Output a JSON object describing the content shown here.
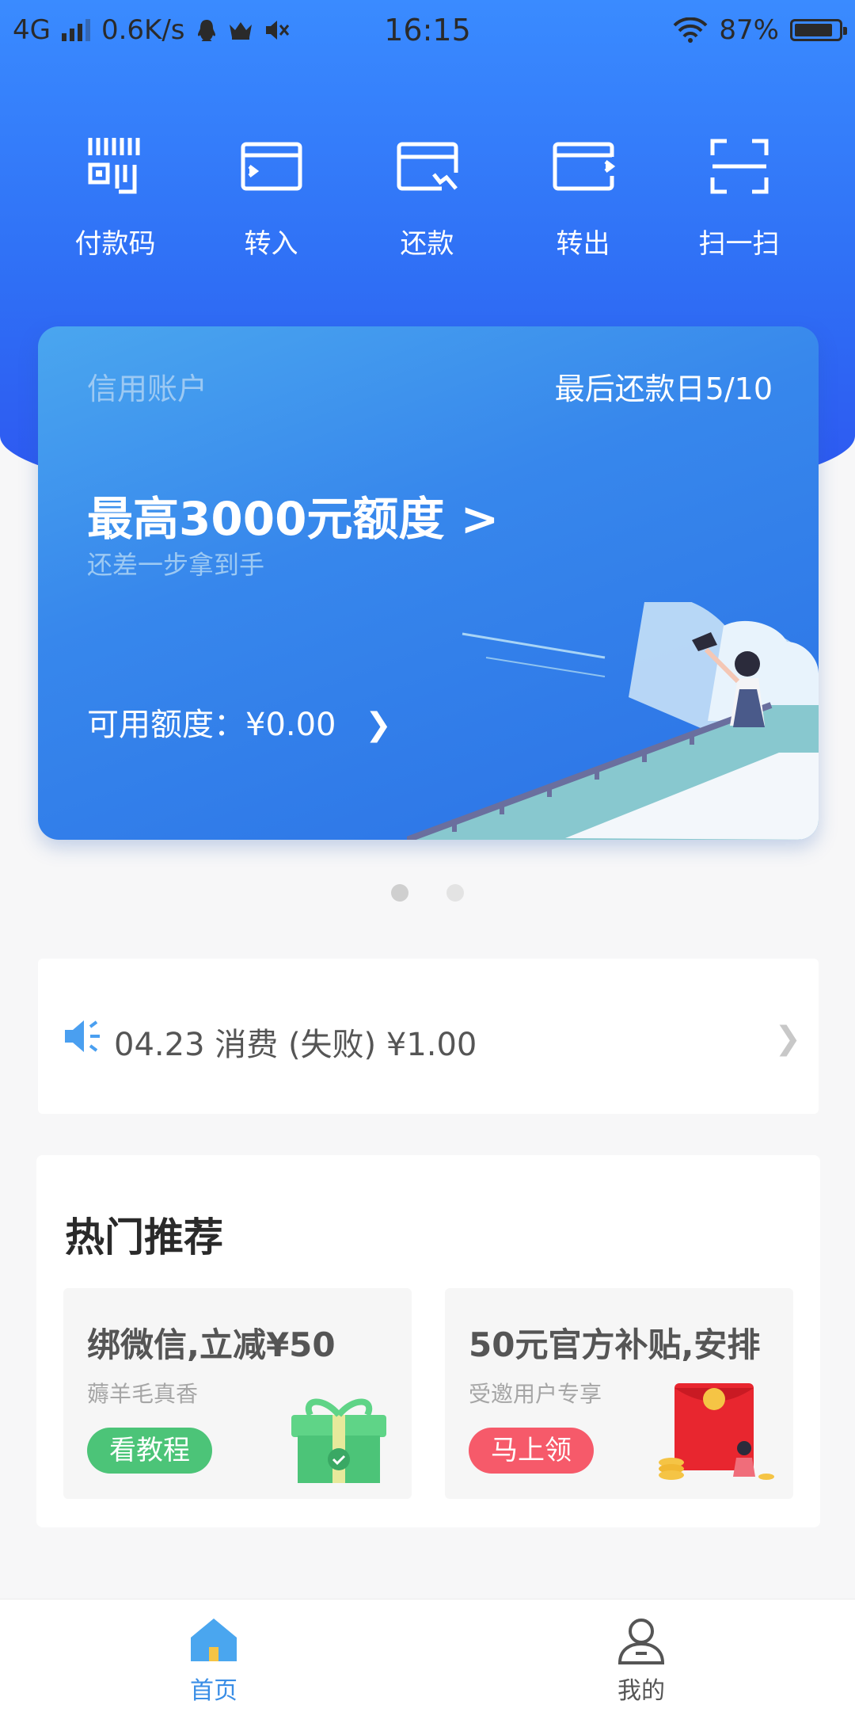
{
  "status_bar": {
    "network": "4G",
    "speed": "0.6K/s",
    "time": "16:15",
    "battery": "87%",
    "battery_level": 0.87
  },
  "quick_actions": [
    {
      "label": "付款码",
      "icon": "barcode-icon"
    },
    {
      "label": "转入",
      "icon": "transfer-in-icon"
    },
    {
      "label": "还款",
      "icon": "repay-icon"
    },
    {
      "label": "转出",
      "icon": "transfer-out-icon"
    },
    {
      "label": "扫一扫",
      "icon": "scan-icon"
    }
  ],
  "credit_card": {
    "account_label": "信用账户",
    "due_date": "最后还款日5/10",
    "limit_text": "最高3000元额度 >",
    "hint": "还差一步拿到手",
    "available": "可用额度：¥0.00"
  },
  "carousel": {
    "pages": 2,
    "active": 1
  },
  "notice": {
    "text": "04.23  消费 (失败)  ¥1.00"
  },
  "hot": {
    "title": "热门推荐",
    "items": [
      {
        "title": "绑微信,立减¥50",
        "subtitle": "薅羊毛真香",
        "button": "看教程",
        "button_color": "#4cc478",
        "icon": "gift-icon"
      },
      {
        "title": "50元官方补贴,安排",
        "subtitle": "受邀用户专享",
        "button": "马上领",
        "button_color": "#f65a6a",
        "icon": "red-envelope-icon"
      }
    ]
  },
  "tabbar": {
    "tabs": [
      {
        "label": "首页",
        "icon": "home-icon",
        "active": true
      },
      {
        "label": "我的",
        "icon": "profile-icon",
        "active": false
      }
    ]
  },
  "colors": {
    "brand": "#2f6ff5",
    "active_tab": "#3a8ee6",
    "inactive_tab": "#555555"
  }
}
